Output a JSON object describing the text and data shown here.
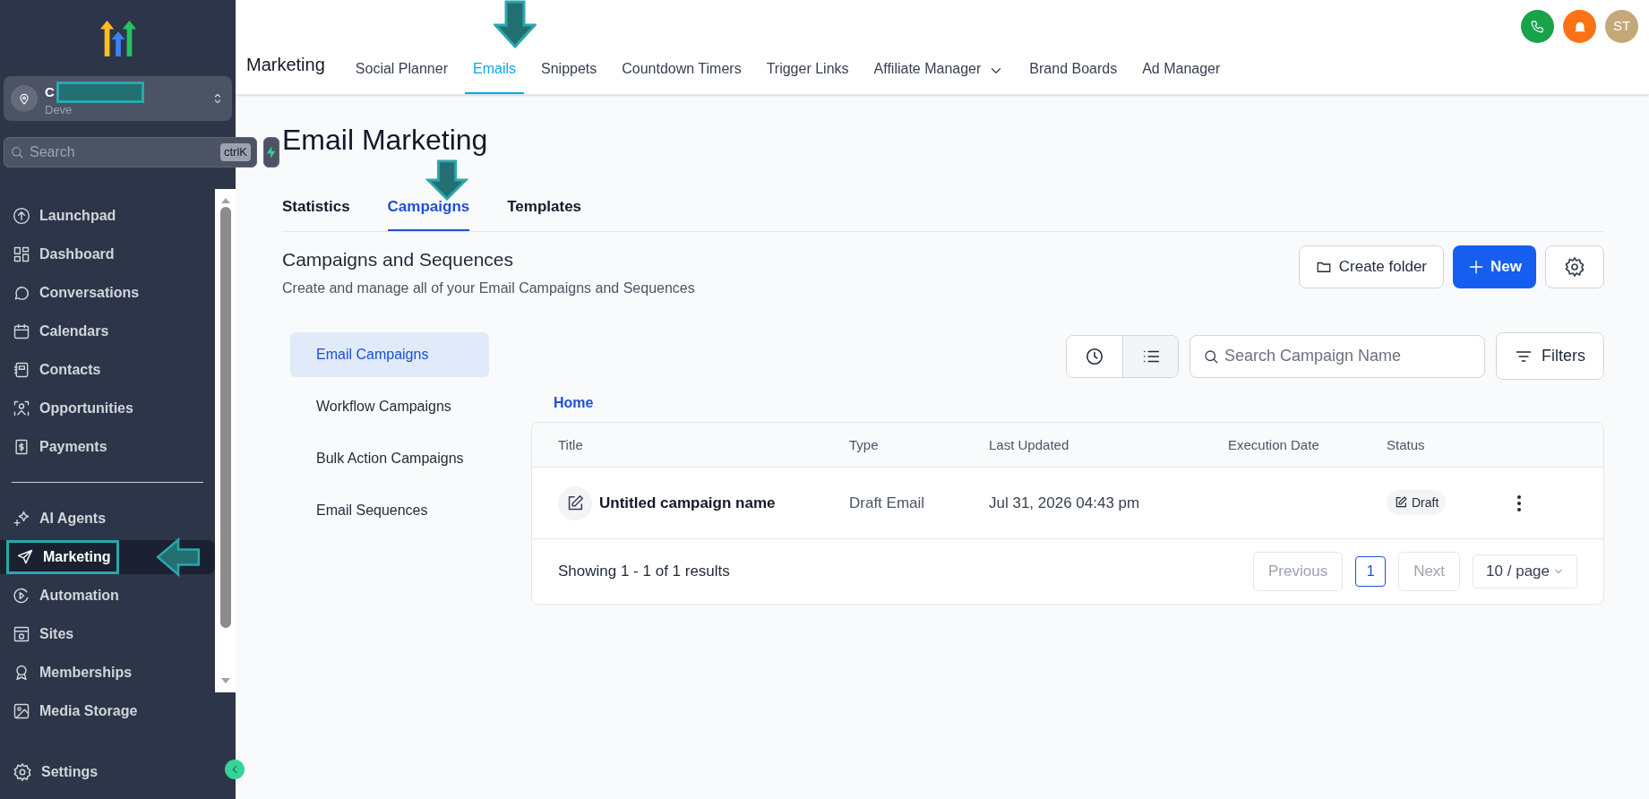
{
  "sidebar": {
    "account": {
      "name": "C",
      "subtitle": "Deve"
    },
    "search": {
      "placeholder": "Search",
      "shortcut": "ctrlK"
    },
    "items": [
      {
        "kind": "launchpad",
        "label": "Launchpad",
        "selected": false
      },
      {
        "kind": "dashboard",
        "label": "Dashboard",
        "selected": false
      },
      {
        "kind": "conversations",
        "label": "Conversations",
        "selected": false
      },
      {
        "kind": "calendars",
        "label": "Calendars",
        "selected": false
      },
      {
        "kind": "contacts",
        "label": "Contacts",
        "selected": false
      },
      {
        "kind": "opportunities",
        "label": "Opportunities",
        "selected": false
      },
      {
        "kind": "payments",
        "label": "Payments",
        "selected": false
      },
      {
        "kind": "divider"
      },
      {
        "kind": "ai",
        "label": "AI Agents",
        "selected": false
      },
      {
        "kind": "marketing",
        "label": "Marketing",
        "selected": true
      },
      {
        "kind": "automation",
        "label": "Automation",
        "selected": false
      },
      {
        "kind": "sites",
        "label": "Sites",
        "selected": false
      },
      {
        "kind": "memberships",
        "label": "Memberships",
        "selected": false
      },
      {
        "kind": "media",
        "label": "Media Storage",
        "selected": false
      }
    ],
    "settings": "Settings"
  },
  "header": {
    "title": "Marketing",
    "tabs": [
      {
        "label": "Social Planner",
        "selected": false
      },
      {
        "label": "Emails",
        "selected": true
      },
      {
        "label": "Snippets",
        "selected": false
      },
      {
        "label": "Countdown Timers",
        "selected": false
      },
      {
        "label": "Trigger Links",
        "selected": false
      },
      {
        "label": "Affiliate Manager",
        "selected": false,
        "dropdown": true
      },
      {
        "label": "Brand Boards",
        "selected": false
      },
      {
        "label": "Ad Manager",
        "selected": false
      }
    ],
    "avatar": "ST"
  },
  "page": {
    "title": "Email Marketing",
    "tabs": [
      {
        "label": "Statistics",
        "selected": false
      },
      {
        "label": "Campaigns",
        "selected": true
      },
      {
        "label": "Templates",
        "selected": false
      }
    ],
    "section_title": "Campaigns and Sequences",
    "section_description": "Create and manage all of your Email Campaigns and Sequences",
    "create_folder": "Create folder",
    "new_button": "New",
    "menu": [
      {
        "label": "Email Campaigns",
        "selected": true
      },
      {
        "label": "Workflow Campaigns",
        "selected": false
      },
      {
        "label": "Bulk Action Campaigns",
        "selected": false
      },
      {
        "label": "Email Sequences",
        "selected": false
      }
    ],
    "view_modes": [
      {
        "kind": "timeline",
        "selected": false
      },
      {
        "kind": "list",
        "selected": true
      }
    ],
    "search": {
      "placeholder": "Search Campaign Name"
    },
    "filters": "Filters",
    "breadcrumb": "Home",
    "table": {
      "columns": [
        "Title",
        "Type",
        "Last Updated",
        "Execution Date",
        "Status"
      ],
      "rows": [
        {
          "title": "Untitled campaign name",
          "type": "Draft Email",
          "last_updated": "Jul 31, 2026 04:43 pm",
          "status": "Draft"
        }
      ]
    },
    "footer": {
      "summary": "Showing 1 - 1 of 1 results",
      "previous": "Previous",
      "page": "1",
      "next": "Next",
      "page_size": "10 / page"
    }
  }
}
